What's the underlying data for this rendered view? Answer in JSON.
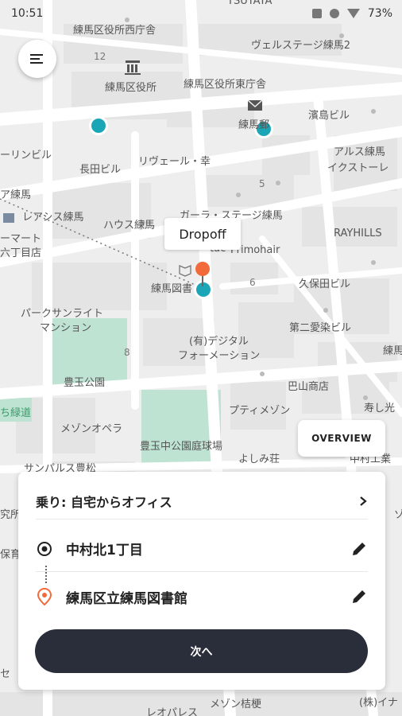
{
  "status_bar": {
    "time": "10:51",
    "battery": "73%"
  },
  "map": {
    "labels": {
      "top": "TSUTAYA",
      "office_n": "練馬区役所西庁舎",
      "block_12": "12",
      "welstage": "ヴェルステージ練馬2",
      "ward_office": "練馬区役所",
      "ward_office_e": "練馬区役所東庁舎",
      "hamashima": "濱島ビル",
      "nerima_post": "練馬郵",
      "linbill": "ーリンビル",
      "nagata": "長田ビル",
      "liveil": "リヴェール・幸",
      "arus": "アルス練馬",
      "ikusutore": "イクストーレ",
      "block_5": "5",
      "amerima": "ア練馬",
      "areasis": "レアシス練馬",
      "house": "ハウス練馬",
      "gora": "ガーラ・ステージ練馬",
      "rayhills": "RAYHILLS",
      "mart": "ーマート",
      "rokuchome": "六丁目店",
      "tac": "tac",
      "primohair": "Primohair",
      "library": "練馬図書",
      "block_6": "6",
      "kubota": "久保田ビル",
      "parksun": "パークサンライト",
      "mansion": "マンション",
      "second_ai": "第二愛染ビル",
      "digital": "(有)デジタル",
      "formation": "フォーメーション",
      "block_8": "8",
      "toshimaen": "豊玉公園",
      "nerimae": "練馬",
      "bayama": "巴山商店",
      "green_road": "ち緑道",
      "petitmaison": "プティメゾン",
      "kotobuki": "寿し光",
      "maison_opera": "メゾンオペラ",
      "toyotama_c": "豊玉中公園庭球場",
      "yoshimiso": "よしみ荘",
      "nakamura_k": "中村工業",
      "sanpals": "サンパルス豊松",
      "shinkyu": "究所",
      "hoiku": "保育",
      "kase": "セ",
      "leopalace": "レオパレス",
      "maison_kikyo": "メゾン桔梗",
      "kabuina": "(株)イナ",
      "ko": "ゾ"
    }
  },
  "tooltip": {
    "text": "Dropoff"
  },
  "overview_button": {
    "label": "OVERVIEW"
  },
  "card": {
    "ride_label": "乗り: 自宅からオフィス",
    "from_label": "中村北1丁目",
    "to_label": "練馬区立練馬図書館",
    "next_label": "次へ"
  },
  "colors": {
    "accent_teal": "#1aa6b7",
    "dropoff_orange": "#f26a3a",
    "park_green": "#bfe3d3",
    "button_dark": "#2a2d3a"
  },
  "icons": {
    "menu": "hamburger-menu-icon",
    "chevron": "chevron-right-icon",
    "origin": "target-circle-icon",
    "destination": "location-pin-icon",
    "edit": "pencil-icon"
  }
}
